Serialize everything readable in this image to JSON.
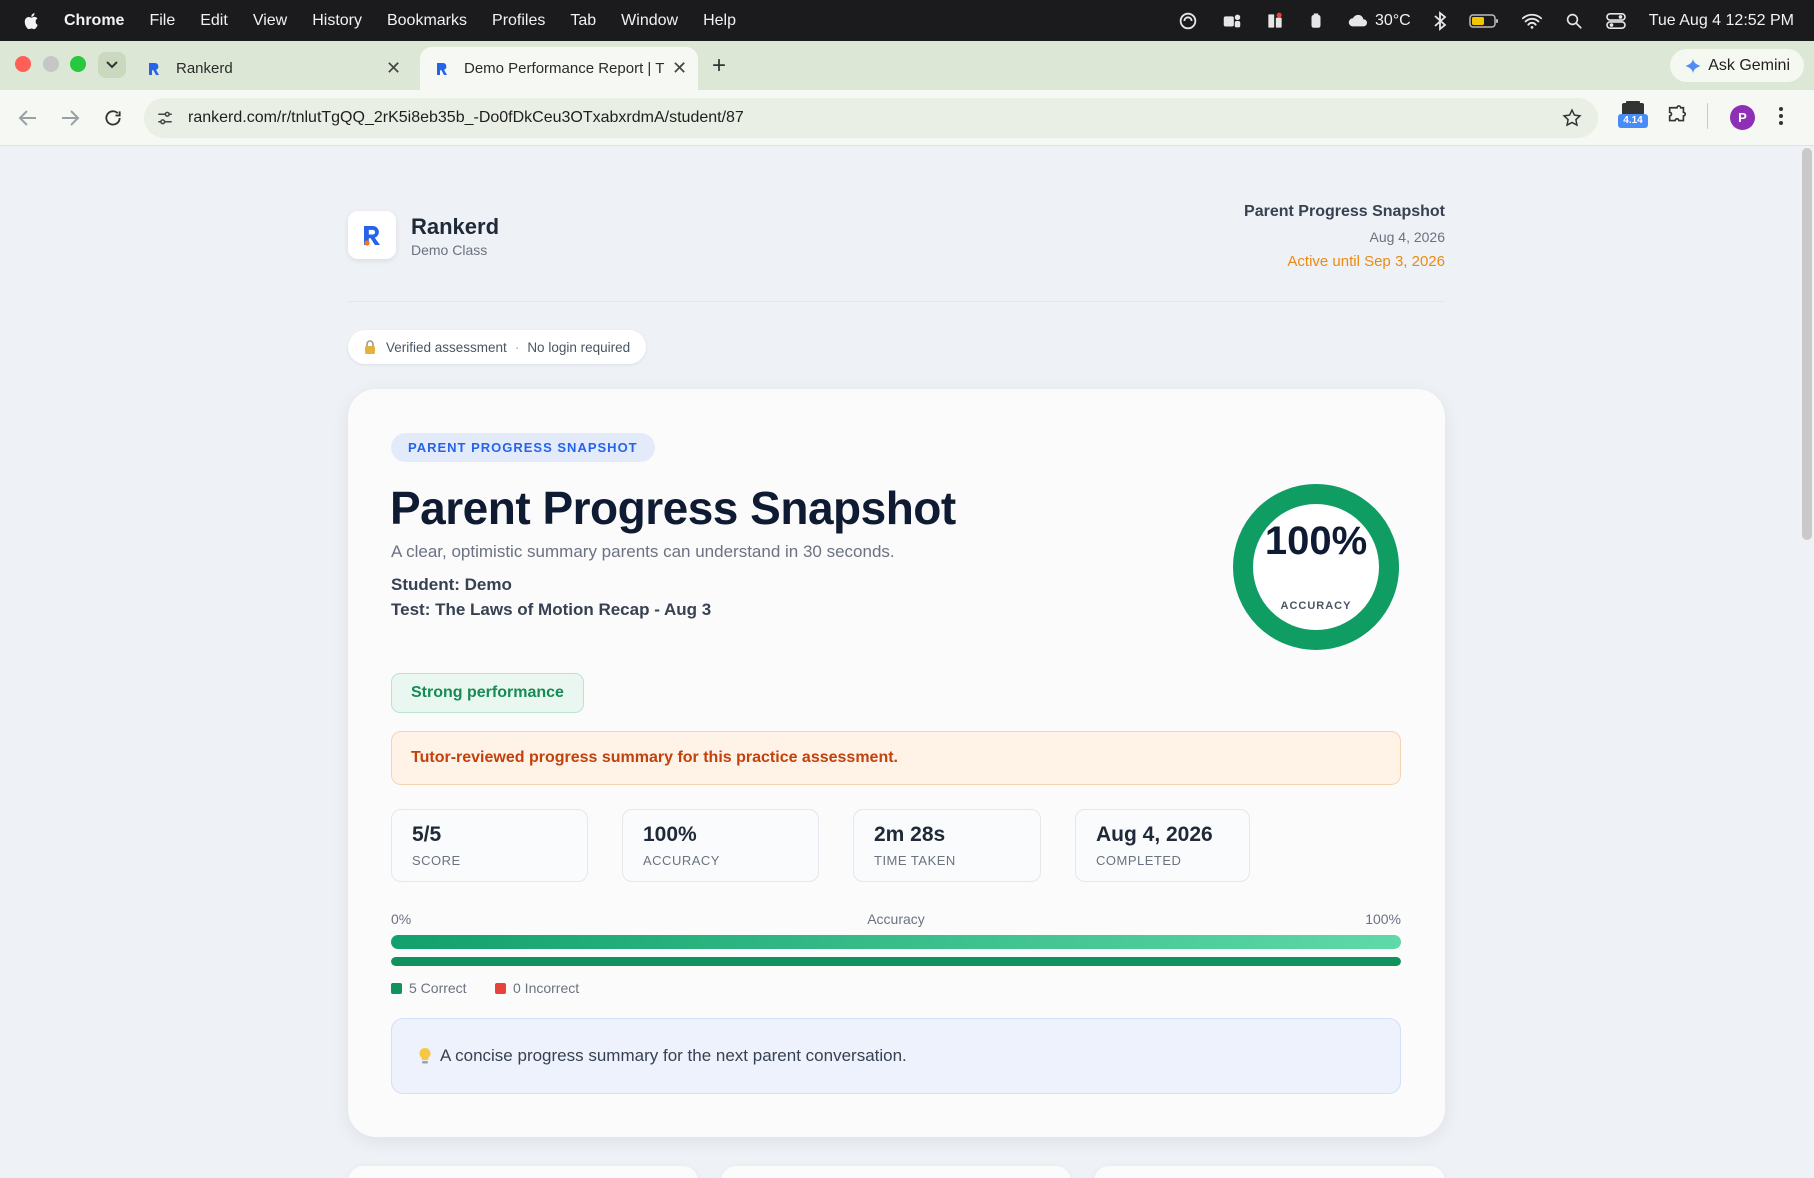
{
  "menubar": {
    "items": [
      "Chrome",
      "File",
      "Edit",
      "View",
      "History",
      "Bookmarks",
      "Profiles",
      "Tab",
      "Window",
      "Help"
    ],
    "weather": "30°C",
    "datetime": "Tue Aug 4  12:52 PM"
  },
  "tabs": [
    {
      "title": "Rankerd",
      "active": false
    },
    {
      "title": "Demo Performance Report | T",
      "active": true
    }
  ],
  "toolbar": {
    "url": "rankerd.com/r/tnlutTgQQ_2rK5i8eb35b_-Do0fDkCeu3OTxabxrdmA/student/87",
    "extension_badge": "4.14",
    "profile_initial": "P",
    "gemini_label": "Ask Gemini"
  },
  "header": {
    "brand": "Rankerd",
    "class_name": "Demo Class",
    "report_title": "Parent Progress Snapshot",
    "date": "Aug 4, 2026",
    "active_until": "Active until Sep 3, 2026"
  },
  "verified": {
    "left": "Verified assessment",
    "sep": "·",
    "right": "No login required"
  },
  "card": {
    "tag": "PARENT PROGRESS SNAPSHOT",
    "title": "Parent Progress Snapshot",
    "subtitle": "A clear, optimistic summary parents can understand in 30 seconds.",
    "student": "Student: Demo",
    "test": "Test: The Laws of Motion Recap - Aug 3",
    "ring": {
      "value": "100%",
      "label": "ACCURACY",
      "fraction": 1.0
    },
    "performance": "Strong performance",
    "notice": "Tutor-reviewed progress summary for this practice assessment.",
    "stats": [
      {
        "value": "5/5",
        "label": "SCORE"
      },
      {
        "value": "100%",
        "label": "ACCURACY"
      },
      {
        "value": "2m 28s",
        "label": "TIME TAKEN"
      },
      {
        "value": "Aug 4, 2026",
        "label": "COMPLETED"
      }
    ],
    "accuracy_bar": {
      "min_label": "0%",
      "mid_label": "Accuracy",
      "max_label": "100%",
      "correct_fraction": 1.0
    },
    "legend": {
      "correct": "5 Correct",
      "incorrect": "0 Incorrect"
    },
    "tip": "A concise progress summary for the next parent conversation."
  },
  "colors": {
    "accent_blue": "#2563eb",
    "success_green": "#10925f",
    "warning_orange": "#ea8a13",
    "error_red": "#e5433b"
  }
}
